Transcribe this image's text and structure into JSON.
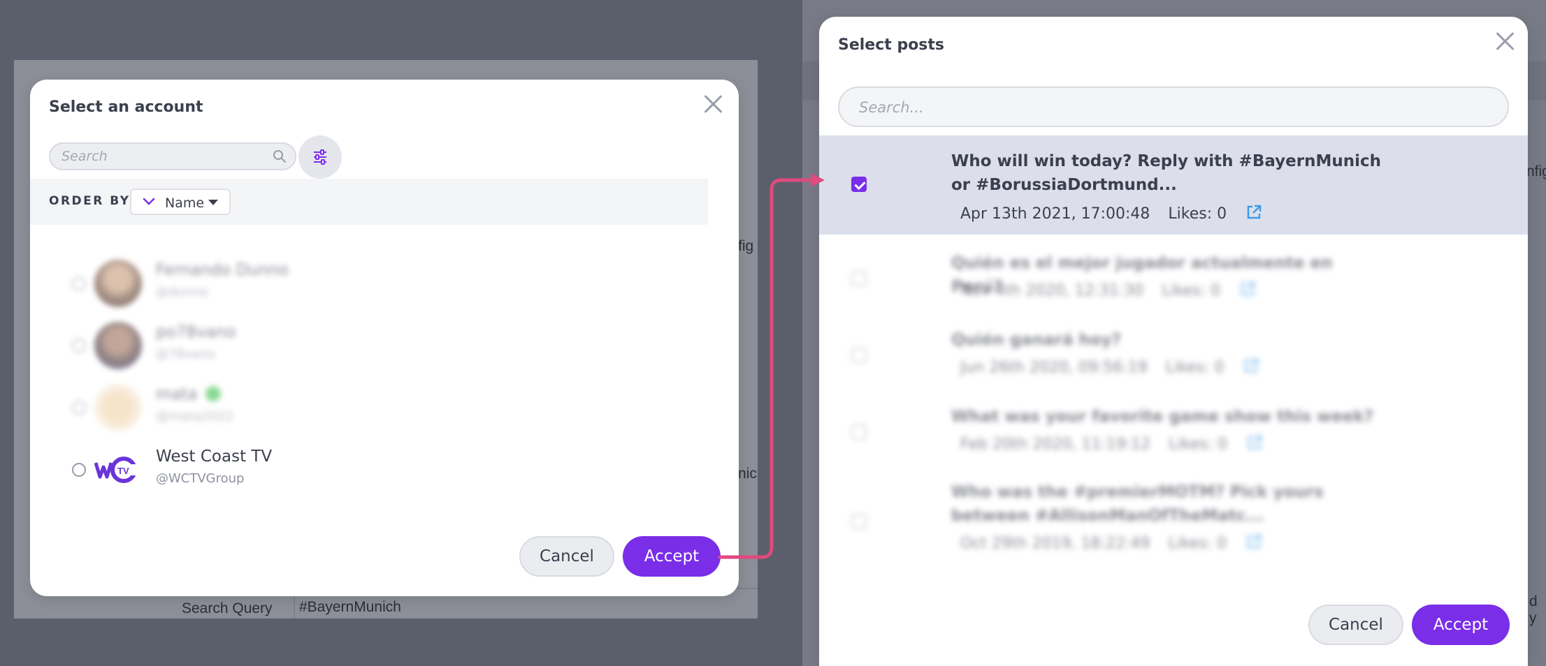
{
  "background": {
    "left_config_fragment": "fig",
    "left_munich_fragment": "nic",
    "search_query_label": "Search Query",
    "search_query_value": "#BayernMunich",
    "right_config_fragment": "nfig",
    "right_end_fragment": "d y"
  },
  "account_dialog": {
    "title": "Select an account",
    "search_placeholder": "Search",
    "order_by_label": "ORDER BY:",
    "order_by_value": "Name",
    "accounts": [
      {
        "name": "Fernando Dunno",
        "handle": "@dunno",
        "blurred": true
      },
      {
        "name": "po78vano",
        "handle": "@78vano",
        "blurred": true
      },
      {
        "name": "mata",
        "handle": "@mata2022",
        "blurred": true
      },
      {
        "name": "West Coast TV",
        "handle": "@WCTVGroup",
        "blurred": false,
        "logo": "WCTV"
      }
    ],
    "cancel_label": "Cancel",
    "accept_label": "Accept"
  },
  "posts_dialog": {
    "title": "Select posts",
    "search_placeholder": "Search...",
    "posts": [
      {
        "text": "Who will win today? Reply with #BayernMunich or #BorussiaDortmund...",
        "date": "Apr 13th 2021, 17:00:48",
        "likes": "Likes: 0",
        "checked": true,
        "blurred": false
      },
      {
        "text": "Quién es el mejor jugador actualmente en Perú?",
        "date": "Nov 4th 2020, 12:31:30",
        "likes": "Likes: 0",
        "checked": false,
        "blurred": true
      },
      {
        "text": "Quién ganará hoy?",
        "date": "Jun 26th 2020, 09:56:19",
        "likes": "Likes: 0",
        "checked": false,
        "blurred": true
      },
      {
        "text": "What was your favorite game show this week?",
        "date": "Feb 20th 2020, 11:19:12",
        "likes": "Likes: 0",
        "checked": false,
        "blurred": true
      },
      {
        "text": "Who was the #premierMOTM? Pick yours between #AllisonManOfTheMatc...",
        "date": "Oct 29th 2019, 18:22:49",
        "likes": "Likes: 0",
        "checked": false,
        "blurred": true
      }
    ],
    "cancel_label": "Cancel",
    "accept_label": "Accept"
  },
  "colors": {
    "accent": "#7a2ee8",
    "connector": "#e04a7e",
    "link_icon": "#3d9be9",
    "selected_row": "#dcdfeb"
  }
}
